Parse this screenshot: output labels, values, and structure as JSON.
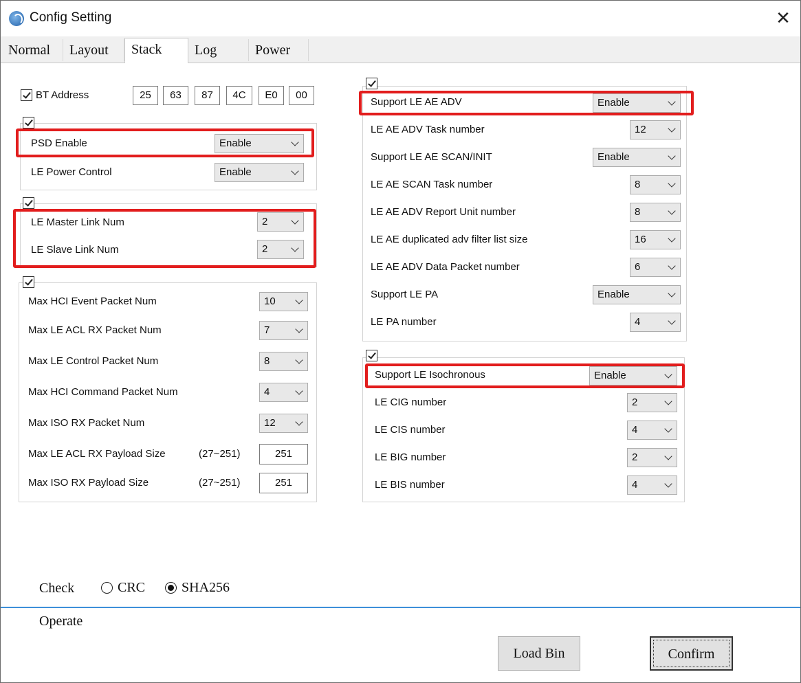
{
  "window": {
    "title": "Config Setting",
    "close_glyph": "✕"
  },
  "tabs": [
    {
      "label": "Normal",
      "active": false
    },
    {
      "label": "Layout",
      "active": false
    },
    {
      "label": "Stack",
      "active": true
    },
    {
      "label": "Log",
      "active": false
    },
    {
      "label": "Power",
      "active": false
    }
  ],
  "bt_address": {
    "label": "BT Address",
    "checked": true,
    "bytes": [
      "25",
      "63",
      "87",
      "4C",
      "E0",
      "00"
    ]
  },
  "psd_group": {
    "checked": true,
    "rows": [
      {
        "label": "PSD Enable",
        "value": "Enable"
      },
      {
        "label": "LE Power Control",
        "value": "Enable"
      }
    ]
  },
  "link_group": {
    "checked": true,
    "rows": [
      {
        "label": "LE Master Link Num",
        "value": "2"
      },
      {
        "label": "LE Slave Link Num",
        "value": "2"
      }
    ]
  },
  "hci_group": {
    "checked": true,
    "rows": [
      {
        "label": "Max HCI Event Packet Num",
        "value": "10"
      },
      {
        "label": "Max LE ACL RX Packet Num",
        "value": "7"
      },
      {
        "label": "Max LE Control Packet Num",
        "value": "8"
      },
      {
        "label": "Max HCI Command Packet Num",
        "value": "4"
      },
      {
        "label": "Max ISO RX Packet Num",
        "value": "12"
      }
    ],
    "text_rows": [
      {
        "label": "Max LE ACL RX Payload Size",
        "range": "(27~251)",
        "value": "251"
      },
      {
        "label": "Max ISO RX Payload Size",
        "range": "(27~251)",
        "value": "251"
      }
    ]
  },
  "ae_group": {
    "checked": true,
    "rows": [
      {
        "label": "Support LE AE ADV",
        "value": "Enable"
      },
      {
        "label": "LE AE ADV Task number",
        "value": "12"
      },
      {
        "label": "Support LE AE SCAN/INIT",
        "value": "Enable"
      },
      {
        "label": "LE AE SCAN Task number",
        "value": "8"
      },
      {
        "label": "LE AE ADV Report Unit number",
        "value": "8"
      },
      {
        "label": "LE AE duplicated adv filter list size",
        "value": "16"
      },
      {
        "label": "LE AE ADV Data Packet number",
        "value": "6"
      },
      {
        "label": "Support LE PA",
        "value": "Enable"
      },
      {
        "label": "LE PA number",
        "value": "4"
      }
    ]
  },
  "iso_group": {
    "checked": true,
    "rows": [
      {
        "label": "Support LE Isochronous",
        "value": "Enable"
      },
      {
        "label": "LE CIG number",
        "value": "2"
      },
      {
        "label": "LE CIS number",
        "value": "4"
      },
      {
        "label": "LE BIG number",
        "value": "2"
      },
      {
        "label": "LE BIS number",
        "value": "4"
      }
    ]
  },
  "check": {
    "label": "Check",
    "options": [
      {
        "label": "CRC",
        "selected": false
      },
      {
        "label": "SHA256",
        "selected": true
      }
    ]
  },
  "operate": {
    "label": "Operate",
    "load_bin": "Load Bin",
    "confirm": "Confirm"
  },
  "colors": {
    "highlight": "#e21d1d",
    "separator": "#3d8fd9"
  }
}
